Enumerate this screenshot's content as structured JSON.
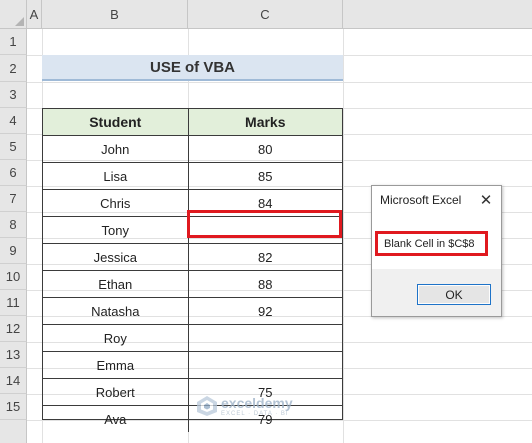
{
  "columns": [
    "A",
    "B",
    "C"
  ],
  "rows": [
    "1",
    "2",
    "3",
    "4",
    "5",
    "6",
    "7",
    "8",
    "9",
    "10",
    "11",
    "12",
    "13",
    "14",
    "15"
  ],
  "sheet": {
    "title": "USE of VBA",
    "headers": [
      "Student",
      "Marks"
    ],
    "records": [
      {
        "student": "John",
        "marks": "80"
      },
      {
        "student": "Lisa",
        "marks": "85"
      },
      {
        "student": "Chris",
        "marks": "84"
      },
      {
        "student": "Tony",
        "marks": ""
      },
      {
        "student": "Jessica",
        "marks": "82"
      },
      {
        "student": "Ethan",
        "marks": "88"
      },
      {
        "student": "Natasha",
        "marks": "92"
      },
      {
        "student": "Roy",
        "marks": ""
      },
      {
        "student": "Emma",
        "marks": ""
      },
      {
        "student": "Robert",
        "marks": "75"
      },
      {
        "student": "Ava",
        "marks": "79"
      }
    ]
  },
  "dialog": {
    "title": "Microsoft Excel",
    "close_glyph": "✕",
    "message": "Blank Cell in $C$8",
    "ok_label": "OK"
  },
  "watermark": {
    "name": "exceldemy",
    "tagline": "EXCEL · DATA · BI"
  },
  "colors": {
    "header_fill": "#e2efda",
    "title_fill": "#dbe5f1",
    "highlight": "#e0191f"
  }
}
